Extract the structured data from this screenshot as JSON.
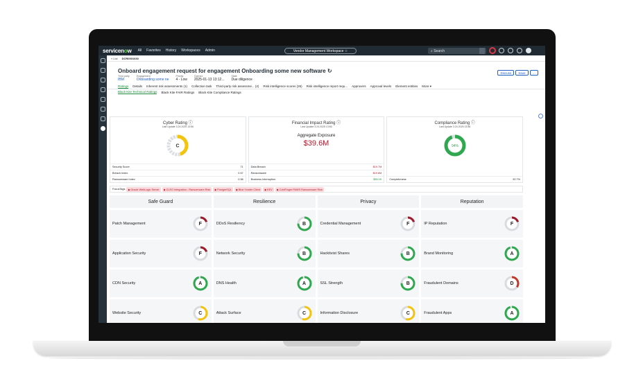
{
  "topnav": {
    "logo_main": "servicen",
    "logo_accent": "o",
    "logo_tail": "w",
    "links": [
      "All",
      "Favorites",
      "History",
      "Workspaces",
      "Admin"
    ],
    "workspace": "Vendor Management Workspace ☆",
    "search_placeholder": "Search"
  },
  "breadcrumb": {
    "back": "« List",
    "record": "DCR0001030"
  },
  "header": {
    "title": "Onboard engagement request for engagement Onboarding some new software",
    "meta": [
      {
        "label": "Third party",
        "value": "IBM",
        "link": true
      },
      {
        "label": "Engagement",
        "value": "Onboarding some ne",
        "link": true
      },
      {
        "label": "Priority",
        "value": "4 - Low",
        "link": false
      },
      {
        "label": "Opened",
        "value": "2025-01-13 13:12...",
        "link": false
      },
      {
        "label": "State",
        "value": "Due diligence",
        "link": false
      }
    ],
    "actions": [
      "Discuss",
      "Save",
      "…"
    ]
  },
  "tabs": [
    "Ratings",
    "Details",
    "Inherent risk assessments (1)",
    "Collection task",
    "Third-party risk assessme... (2)",
    "Risk intelligence scores (26)",
    "Risk intelligence report requ...",
    "Approvers",
    "Approval levels",
    "Element entities",
    "More ▾"
  ],
  "subtabs": [
    "Black Kite Technical Ratings",
    "Black Kite FAIR Ratings",
    "Black Kite Compliance Ratings"
  ],
  "cyber": {
    "title": "Cyber Rating ⓘ",
    "updated": "Last Update 3.24.2025 13:56",
    "grade": "C",
    "ring_color": "#f2c40f",
    "ring_fraction": 0.45,
    "rows": [
      {
        "label": "Security Score",
        "value": "71"
      },
      {
        "label": "Breach Index",
        "value": "0.67"
      },
      {
        "label": "Ransomware Index",
        "value": "0.58"
      }
    ]
  },
  "financial": {
    "title": "Financial Impact Rating ⓘ",
    "updated": "Last Update 3.24.2025 13:56",
    "agg_label": "Aggregate Exposure",
    "agg_value": "$39.6M",
    "rows": [
      {
        "label": "Data Breach",
        "value": "$19.7M",
        "tone": "red"
      },
      {
        "label": "Ransomware",
        "value": "$19.8M",
        "tone": "red"
      },
      {
        "label": "Business Interruption",
        "value": "$55.1K",
        "tone": "green"
      }
    ]
  },
  "compliance": {
    "title": "Compliance Rating ⓘ",
    "updated": "Last Update 3.24.2025 13:56",
    "percent_label": "94%",
    "percent": 0.94,
    "ring_color": "#2fa84f",
    "rows": [
      {
        "label": "Completeness",
        "value": "92.7%"
      }
    ]
  },
  "focus": {
    "label": "FocusTags",
    "tags": [
      "Oracle WebLogic Server",
      "CLEO Integration - Ransomware Risk",
      "PostgreSQL",
      "Blue Yonder Client",
      "KEV",
      "ColdFinger PAWS Ransomware Risk"
    ]
  },
  "categories": [
    "Safe Guard",
    "Resilience",
    "Privacy",
    "Reputation"
  ],
  "grade_colors": {
    "A": "#2fa84f",
    "B": "#2fa84f",
    "C": "#f2c40f",
    "D": "#c0392b",
    "F": "#9b1c2c"
  },
  "grade_fill": {
    "A": 0.95,
    "B": 0.75,
    "C": 0.55,
    "D": 0.35,
    "F": 0.2
  },
  "grid": [
    [
      {
        "label": "Patch Management",
        "grade": "F"
      },
      {
        "label": "DDoS Resiliency",
        "grade": "B"
      },
      {
        "label": "Credential Management",
        "grade": "F"
      },
      {
        "label": "IP Reputation",
        "grade": "F"
      }
    ],
    [
      {
        "label": "Application Security",
        "grade": "F"
      },
      {
        "label": "Network Security",
        "grade": "B"
      },
      {
        "label": "Hacktivist Shares",
        "grade": "B"
      },
      {
        "label": "Brand Monitoring",
        "grade": "A"
      }
    ],
    [
      {
        "label": "CDN Security",
        "grade": "A"
      },
      {
        "label": "DNS Health",
        "grade": "A"
      },
      {
        "label": "SSL Strength",
        "grade": "B"
      },
      {
        "label": "Fraudulent Domains",
        "grade": "D"
      }
    ],
    [
      {
        "label": "Website Security",
        "grade": "C"
      },
      {
        "label": "Attack Surface",
        "grade": "C"
      },
      {
        "label": "Information Disclosure",
        "grade": "C"
      },
      {
        "label": "Fraudulent Apps",
        "grade": "A"
      }
    ]
  ]
}
